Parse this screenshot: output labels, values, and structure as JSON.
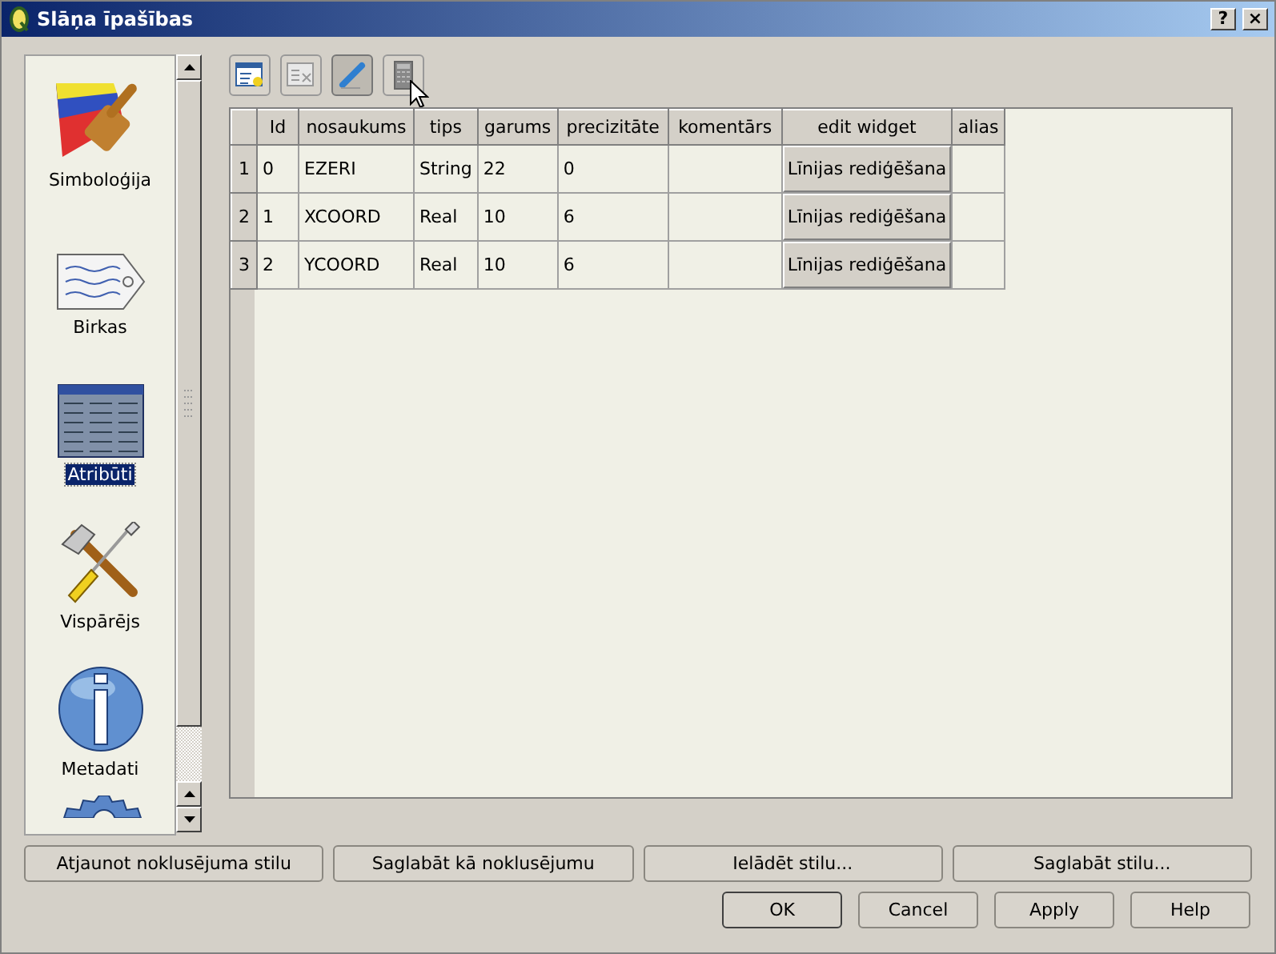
{
  "window": {
    "title": "Slāņa īpašības",
    "help_button": "?",
    "close_button": "×"
  },
  "sidebar": {
    "items": [
      {
        "label": "Simboloģija",
        "selected": false
      },
      {
        "label": "Birkas",
        "selected": false
      },
      {
        "label": "Atribūti",
        "selected": true
      },
      {
        "label": "Vispārējs",
        "selected": false
      },
      {
        "label": "Metadati",
        "selected": false
      }
    ]
  },
  "toolbar": [
    {
      "on": false
    },
    {
      "on": false
    },
    {
      "on": true
    },
    {
      "on": false
    }
  ],
  "table": {
    "columns": [
      "Id",
      "nosaukums",
      "tips",
      "garums",
      "precizitāte",
      "komentārs",
      "edit widget",
      "alias"
    ],
    "rows": [
      {
        "header": "1",
        "cells": [
          "0",
          "EZERI",
          "String",
          "22",
          "0",
          "",
          "Līnijas rediģēšana",
          ""
        ]
      },
      {
        "header": "2",
        "cells": [
          "1",
          "XCOORD",
          "Real",
          "10",
          "6",
          "",
          "Līnijas rediģēšana",
          ""
        ]
      },
      {
        "header": "3",
        "cells": [
          "2",
          "YCOORD",
          "Real",
          "10",
          "6",
          "",
          "Līnijas rediģēšana",
          ""
        ]
      }
    ]
  },
  "style_buttons": [
    "Atjaunot noklusējuma stilu",
    "Saglabāt kā noklusējumu",
    "Ielādēt stilu...",
    "Saglabāt stilu..."
  ],
  "dialog_buttons": [
    "OK",
    "Cancel",
    "Apply",
    "Help"
  ]
}
